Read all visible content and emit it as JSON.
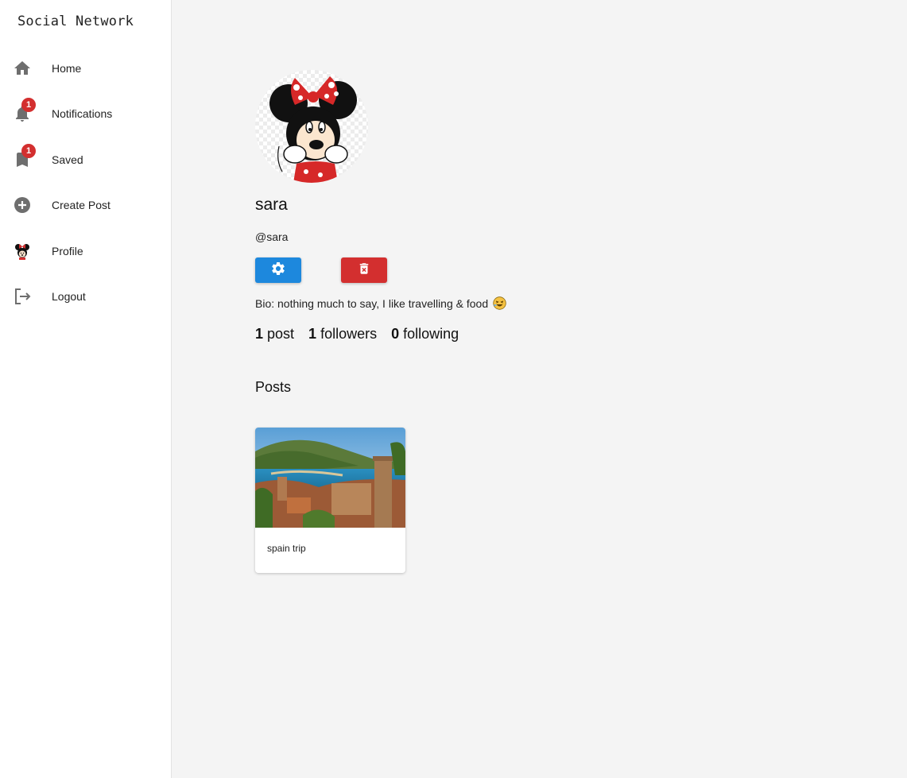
{
  "app": {
    "title": "Social Network"
  },
  "sidebar": {
    "items": [
      {
        "label": "Home",
        "icon": "home-icon"
      },
      {
        "label": "Notifications",
        "icon": "bell-icon",
        "badge": "1"
      },
      {
        "label": "Saved",
        "icon": "bookmark-icon",
        "badge": "1"
      },
      {
        "label": "Create Post",
        "icon": "add-circle-icon"
      },
      {
        "label": "Profile",
        "icon": "avatar"
      },
      {
        "label": "Logout",
        "icon": "logout-icon"
      }
    ]
  },
  "profile": {
    "name": "sara",
    "handle": "@sara",
    "bio": "Bio: nothing much to say, I like travelling & food",
    "stats": {
      "posts_count": "1",
      "posts_label": "post",
      "followers_count": "1",
      "followers_label": "followers",
      "following_count": "0",
      "following_label": "following"
    }
  },
  "posts_section": {
    "title": "Posts"
  },
  "posts": [
    {
      "caption": "spain trip"
    }
  ],
  "colors": {
    "settings_button": "#1d88dd",
    "delete_button": "#d32f2f",
    "badge": "#d32f2f",
    "icon_gray": "#6e6e6e"
  }
}
